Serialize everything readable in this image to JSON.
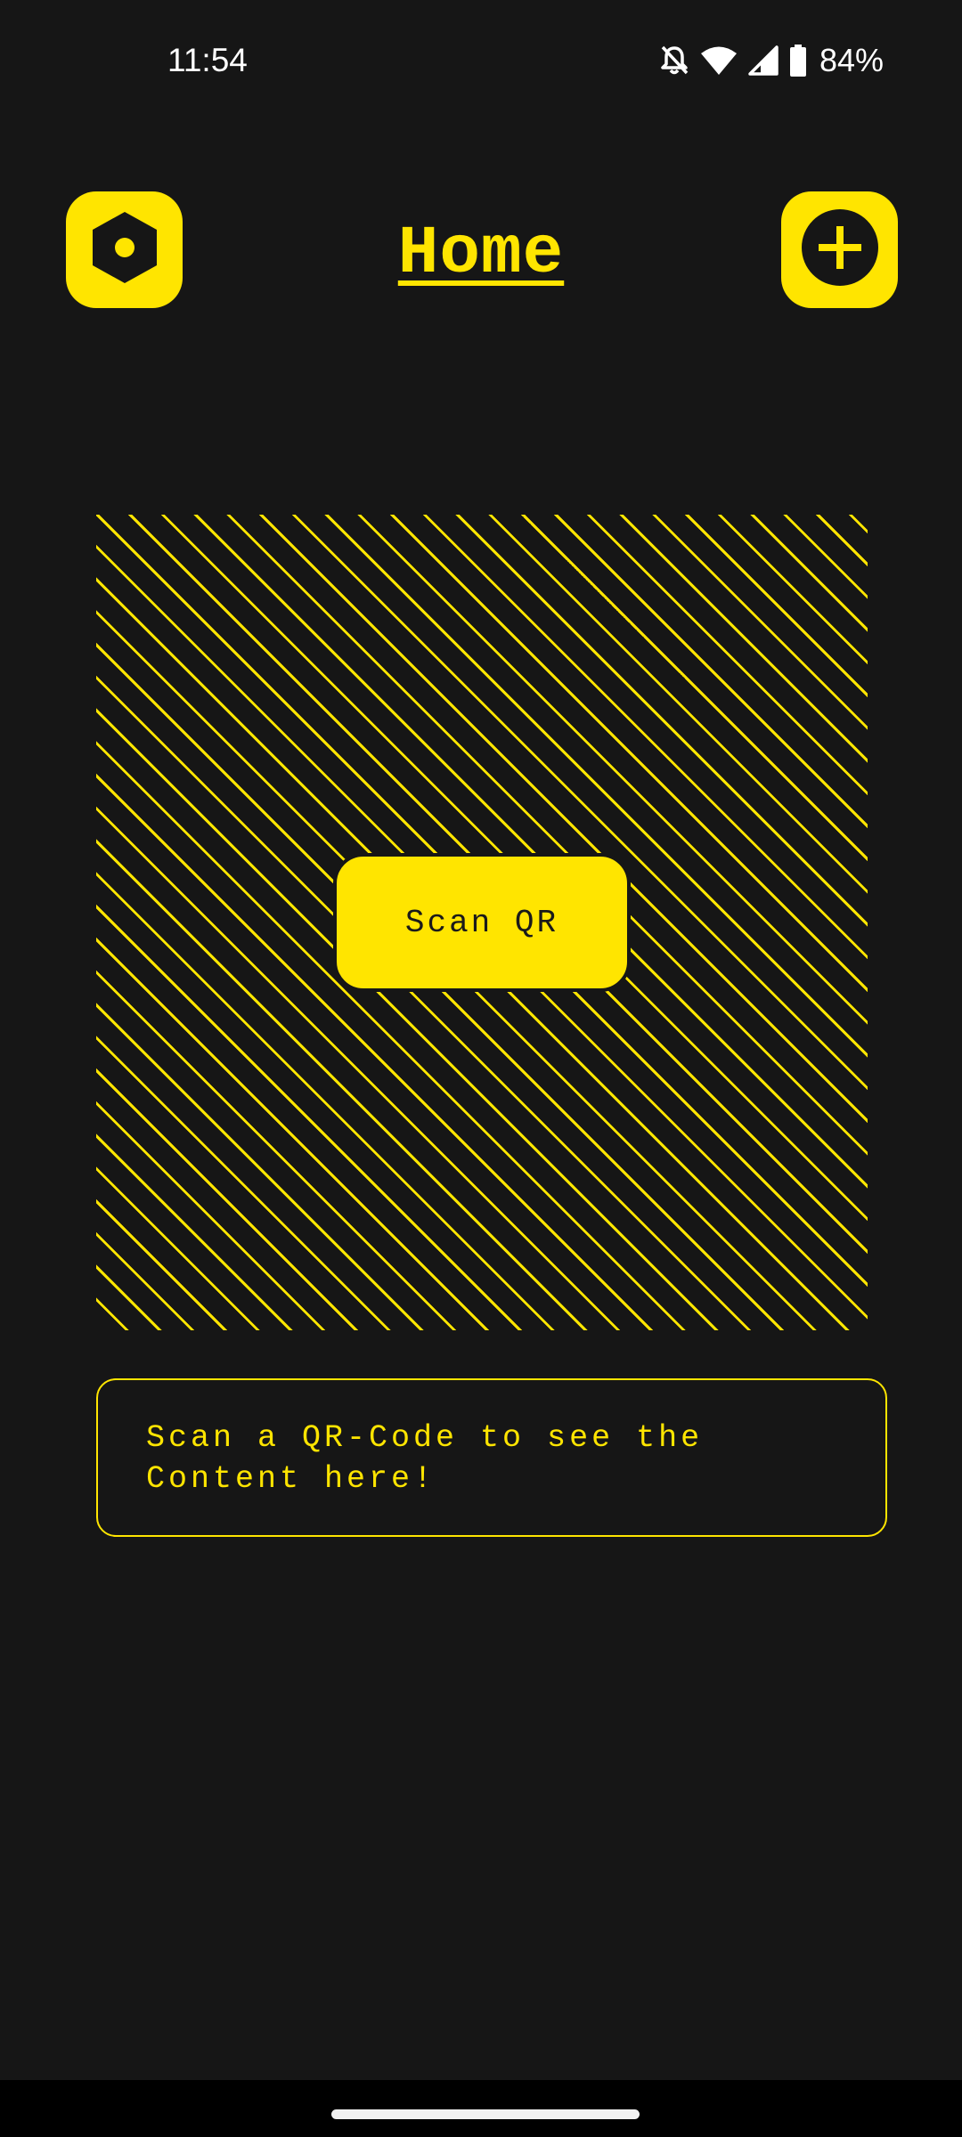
{
  "status_bar": {
    "time": "11:54",
    "battery_percent": "84%",
    "icons": [
      "notifications-off-icon",
      "wifi-icon",
      "cellular-signal-icon",
      "battery-icon"
    ]
  },
  "header": {
    "title": "Home",
    "left_button_icon": "settings-hexagon-icon",
    "right_button_icon": "add-circle-icon"
  },
  "scanner": {
    "button_label": "Scan QR"
  },
  "result": {
    "placeholder": "Scan a QR-Code to see the Content here!"
  },
  "colors": {
    "background": "#161616",
    "accent": "#FFE500"
  }
}
